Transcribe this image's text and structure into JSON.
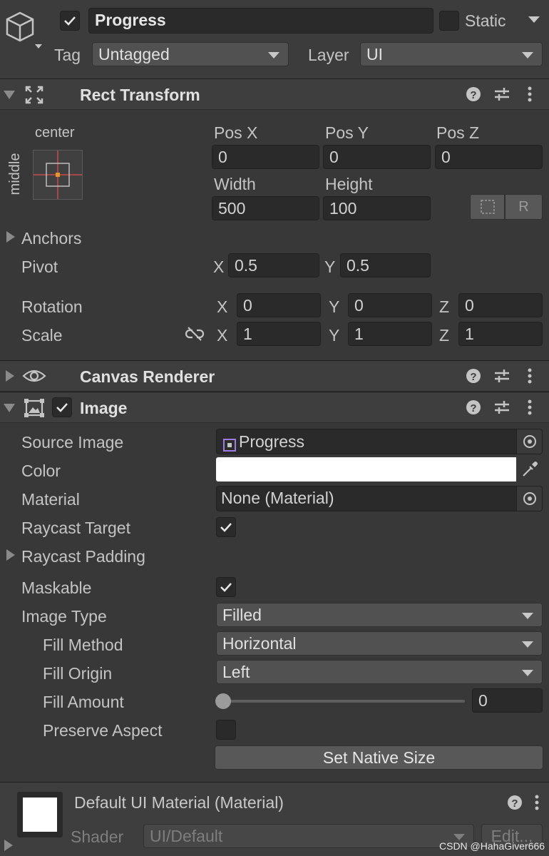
{
  "gameobject": {
    "name": "Progress",
    "active": true,
    "static_label": "Static",
    "static_checked": false,
    "tag_label": "Tag",
    "tag_value": "Untagged",
    "layer_label": "Layer",
    "layer_value": "UI"
  },
  "rect_transform": {
    "title": "Rect Transform",
    "anchor_h_label": "center",
    "anchor_v_label": "middle",
    "pos_x_label": "Pos X",
    "pos_y_label": "Pos Y",
    "pos_z_label": "Pos Z",
    "pos_x": "0",
    "pos_y": "0",
    "pos_z": "0",
    "width_label": "Width",
    "height_label": "Height",
    "width": "500",
    "height": "100",
    "raw_button": "R",
    "anchors_label": "Anchors",
    "pivot_label": "Pivot",
    "pivot_x": "0.5",
    "pivot_y": "0.5",
    "rotation_label": "Rotation",
    "rotation_x": "0",
    "rotation_y": "0",
    "rotation_z": "0",
    "scale_label": "Scale",
    "scale_x": "1",
    "scale_y": "1",
    "scale_z": "1",
    "axis_x": "X",
    "axis_y": "Y",
    "axis_z": "Z"
  },
  "canvas_renderer": {
    "title": "Canvas Renderer"
  },
  "image": {
    "title": "Image",
    "enabled": true,
    "source_image_label": "Source Image",
    "source_image_value": "Progress",
    "color_label": "Color",
    "color_value": "#ffffff",
    "material_label": "Material",
    "material_value": "None (Material)",
    "raycast_target_label": "Raycast Target",
    "raycast_target": true,
    "raycast_padding_label": "Raycast Padding",
    "maskable_label": "Maskable",
    "maskable": true,
    "image_type_label": "Image Type",
    "image_type_value": "Filled",
    "fill_method_label": "Fill Method",
    "fill_method_value": "Horizontal",
    "fill_origin_label": "Fill Origin",
    "fill_origin_value": "Left",
    "fill_amount_label": "Fill Amount",
    "fill_amount_value": "0",
    "preserve_aspect_label": "Preserve Aspect",
    "preserve_aspect": false,
    "set_native_size_label": "Set Native Size"
  },
  "material": {
    "title": "Default UI Material (Material)",
    "shader_label": "Shader",
    "shader_value": "UI/Default",
    "edit_label": "Edit..."
  },
  "watermark": "CSDN @HahaGiver666",
  "colors": {
    "background": "#383838",
    "header": "#3e3e3e",
    "field": "#2a2a2a",
    "accent_orange": "#e8962a",
    "anchor_red": "#c84a4a"
  }
}
